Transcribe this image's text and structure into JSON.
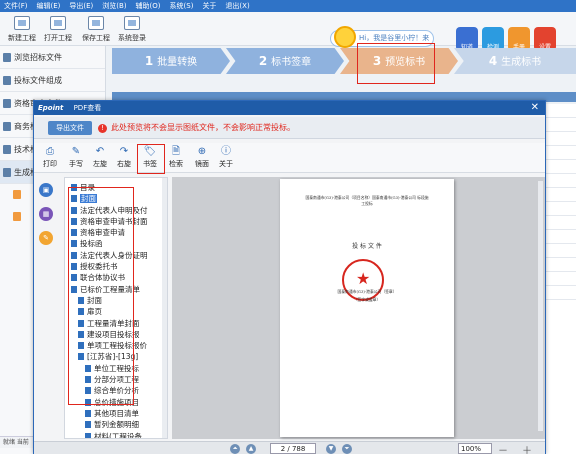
{
  "menubar": [
    "文件(F)",
    "编辑(E)",
    "导出(E)",
    "浏览(B)",
    "辅助(O)",
    "系统(S)",
    "关于",
    "退出(X)"
  ],
  "toolbar": {
    "new": "新建工程",
    "open": "打开工程",
    "save": "保存工程",
    "login": "系统登录"
  },
  "tip": "Hi，我是谷里小柠！来留言吗",
  "rightButtons": [
    {
      "label": "知道",
      "color": "#3a6fd2"
    },
    {
      "label": "检测",
      "color": "#2c9be0"
    },
    {
      "label": "手册",
      "color": "#f0962e"
    },
    {
      "label": "设置",
      "color": "#e3432f"
    }
  ],
  "sidebar": {
    "items": [
      "浏览招标文件",
      "投标文件组成",
      "资格审查文件",
      "商务标",
      "技术标",
      "生成标书"
    ]
  },
  "status": "就绪  当前",
  "steps": [
    {
      "num": "1",
      "label": "批量转换",
      "active": false
    },
    {
      "num": "2",
      "label": "标书签章",
      "active": false
    },
    {
      "num": "3",
      "label": "预览标书",
      "active": true
    },
    {
      "num": "4",
      "label": "生成标书",
      "active": false
    }
  ],
  "dialog": {
    "logo": "Epoint",
    "title": "PDF查看",
    "export": "导出文件",
    "warning": "此处预览将不会显示图纸文件，不会影响正常投标。",
    "tools": [
      "打印",
      "手写",
      "左旋",
      "右旋",
      "书签",
      "检索",
      "镜面",
      "关于"
    ],
    "outline": [
      {
        "t": "目录",
        "l": 0
      },
      {
        "t": "封面",
        "l": 0,
        "hl": true
      },
      {
        "t": "法定代表人申明及付",
        "l": 0
      },
      {
        "t": "资格审查申请书封面",
        "l": 0
      },
      {
        "t": "资格审查申请",
        "l": 0
      },
      {
        "t": "投标函",
        "l": 0
      },
      {
        "t": "法定代表人身份证明",
        "l": 0
      },
      {
        "t": "授权委托书",
        "l": 0
      },
      {
        "t": "联合体协议书",
        "l": 0
      },
      {
        "t": "已标价工程量清单",
        "l": 0
      },
      {
        "t": "封面",
        "l": 1
      },
      {
        "t": "扉页",
        "l": 1
      },
      {
        "t": "工程量清单封面",
        "l": 1
      },
      {
        "t": "建设项目投标报",
        "l": 1
      },
      {
        "t": "单项工程投标报价",
        "l": 1
      },
      {
        "t": "[江苏省]-[13g]",
        "l": 1
      },
      {
        "t": "单位工程投标",
        "l": 2
      },
      {
        "t": "分部分项工程",
        "l": 2
      },
      {
        "t": "综合单价分析",
        "l": 2
      },
      {
        "t": "总价措施项目",
        "l": 2
      },
      {
        "t": "其他项目清单",
        "l": 2
      },
      {
        "t": "暂列金额明细",
        "l": 2
      },
      {
        "t": "材料(工程设备",
        "l": 2
      }
    ],
    "page": {
      "line1": "国泰南通市(G3)-港泰公司（项目名称）国泰南通市(G3)-港泰公司 标段施",
      "line2": "工投标",
      "doctitle": "投 标 文 件",
      "line3": "国泰南通市(G3)-港泰公司（签章）",
      "line4": "（签字或盖章）"
    },
    "pager": "2 / 788",
    "zoom": "100%"
  }
}
